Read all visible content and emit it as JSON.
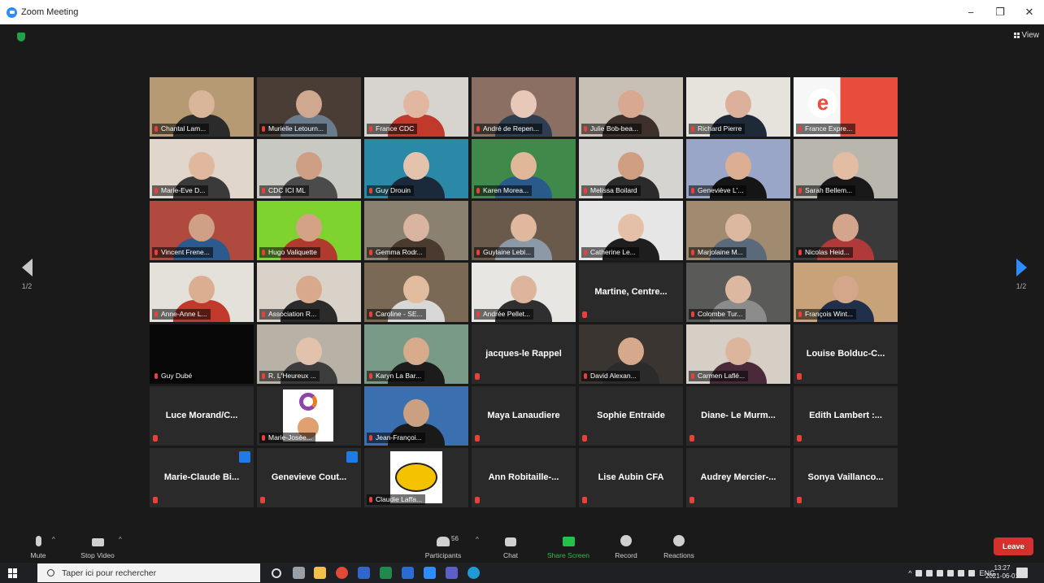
{
  "window": {
    "title": "Zoom Meeting",
    "minimize": "−",
    "maximize": "❐",
    "close": "✕"
  },
  "view": {
    "label": "View"
  },
  "pager": {
    "left": "1/2",
    "right": "1/2"
  },
  "tiles": [
    {
      "type": "video",
      "name": "Chantal Lam...",
      "bg": "#b59a73",
      "skin": "#d9b59a",
      "shirt": "#2b2b2b"
    },
    {
      "type": "video",
      "name": "Murielle Letourn...",
      "bg": "#4a3d35",
      "skin": "#d0a890",
      "shirt": "#6a7b8c"
    },
    {
      "type": "video",
      "name": "France  CDC",
      "bg": "#d7d3cf",
      "skin": "#e2b7a0",
      "shirt": "#c0392b"
    },
    {
      "type": "video",
      "name": "André de Repen...",
      "bg": "#8b6f62",
      "skin": "#e8c8b8",
      "shirt": "#2c3e50"
    },
    {
      "type": "video",
      "name": "Julie Bob-bea...",
      "bg": "#c8c0b4",
      "skin": "#d8a890",
      "shirt": "#3d2f2a"
    },
    {
      "type": "video",
      "name": "Richard Pierre",
      "bg": "#e6e3dd",
      "skin": "#dcb09a",
      "shirt": "#1f2a38"
    },
    {
      "type": "logo",
      "name": "France  Expre...",
      "bg": "#f7f7f7",
      "accent": "#e74c3c"
    },
    {
      "type": "video",
      "name": "Marie-Eve D...",
      "bg": "#e0d6cb",
      "skin": "#e0b89d",
      "shirt": "#3a3a3a"
    },
    {
      "type": "video",
      "name": "CDC ICI ML",
      "bg": "#c9c9c4",
      "skin": "#cf9f85",
      "shirt": "#4b4b4b"
    },
    {
      "type": "video",
      "name": "Guy Drouin",
      "bg": "#2b89a8",
      "skin": "#e4c3ad",
      "shirt": "#1b2a3a"
    },
    {
      "type": "video",
      "name": "Karen Morea...",
      "bg": "#3f8a4a",
      "skin": "#e0b798",
      "shirt": "#2a5a8a"
    },
    {
      "type": "video",
      "name": "Melissa Boilard",
      "bg": "#d6d4d0",
      "skin": "#d09f82",
      "shirt": "#2b2b2b"
    },
    {
      "type": "video",
      "name": "Geneviève L'...",
      "bg": "#9aa6c8",
      "skin": "#dcae92",
      "shirt": "#151515"
    },
    {
      "type": "video",
      "name": "Sarah Bellem...",
      "bg": "#b9b6ae",
      "skin": "#e2bca3",
      "shirt": "#181818"
    },
    {
      "type": "video",
      "name": "Vincent Frene...",
      "bg": "#b04a3e",
      "skin": "#cfa086",
      "shirt": "#2d5a8c"
    },
    {
      "type": "video",
      "name": "Hugo Valiquette",
      "bg": "#7ed32e",
      "skin": "#d4a284",
      "shirt": "#b03a2e",
      "active": true
    },
    {
      "type": "video",
      "name": "Gemma Rodr...",
      "bg": "#8a8170",
      "skin": "#d9b4a0",
      "shirt": "#4a3a30"
    },
    {
      "type": "video",
      "name": "Guylaine Lebl...",
      "bg": "#6a5a4c",
      "skin": "#dfb89e",
      "shirt": "#8c9aa8"
    },
    {
      "type": "video",
      "name": "Catherine Le...",
      "bg": "#e6e6e6",
      "skin": "#e5c0a8",
      "shirt": "#1e1e1e"
    },
    {
      "type": "video",
      "name": "Marjolaine M...",
      "bg": "#a08b70",
      "skin": "#ddb8a0",
      "shirt": "#5a6a7a"
    },
    {
      "type": "video",
      "name": "Nicolas Heid...",
      "bg": "#3a3a3a",
      "skin": "#d3a58c",
      "shirt": "#b03a3a"
    },
    {
      "type": "video",
      "name": "Anne-Anne L...",
      "bg": "#e4e0da",
      "skin": "#dbae92",
      "shirt": "#c0392b"
    },
    {
      "type": "video",
      "name": "Association R...",
      "bg": "#d8d2c9",
      "skin": "#d9a98d",
      "shirt": "#2b2b2b"
    },
    {
      "type": "video",
      "name": "Caroline - SE...",
      "bg": "#7a6a55",
      "skin": "#e1bc9f",
      "shirt": "#d8d8d8"
    },
    {
      "type": "video",
      "name": "Andrée Pellet...",
      "bg": "#e8e6e2",
      "skin": "#ddb49c",
      "shirt": "#2f2f2f"
    },
    {
      "type": "text",
      "name": "Martine,  Centre..."
    },
    {
      "type": "video",
      "name": "Colombe Tur...",
      "bg": "#5a5a58",
      "skin": "#dcb8a1",
      "shirt": "#8c8c8c"
    },
    {
      "type": "video",
      "name": "François Wint...",
      "bg": "#c8a278",
      "skin": "#d4a68a",
      "shirt": "#20304a"
    },
    {
      "type": "black",
      "name": "Guy Dubé"
    },
    {
      "type": "video",
      "name": "R. L'Heureux ...",
      "bg": "#b8b1a5",
      "skin": "#e3c2ad",
      "shirt": "#3c3c3c"
    },
    {
      "type": "video",
      "name": "Karyn La Bar...",
      "bg": "#7a9a88",
      "skin": "#d9ab8d",
      "shirt": "#1c1c1c"
    },
    {
      "type": "text",
      "name": "jacques-le Rappel"
    },
    {
      "type": "video",
      "name": "David Alexan...",
      "bg": "#3a3530",
      "skin": "#d6a98c",
      "shirt": "#2b2b2b"
    },
    {
      "type": "video",
      "name": "Carmen Laflé...",
      "bg": "#d5cfc6",
      "skin": "#ddb59c",
      "shirt": "#4a2a3a"
    },
    {
      "type": "text",
      "name": "Louise  Bolduc-C..."
    },
    {
      "type": "text",
      "name": "Luce  Morand/C..."
    },
    {
      "type": "logo1",
      "name": "Marie-Josée..."
    },
    {
      "type": "video",
      "name": "Jean-Françoi...",
      "bg": "#3a6fb0",
      "skin": "#caa080",
      "shirt": "#1a1a1a"
    },
    {
      "type": "text",
      "name": "Maya Lanaudiere"
    },
    {
      "type": "text",
      "name": "Sophie Entraide"
    },
    {
      "type": "text",
      "name": "Diane- Le Murm..."
    },
    {
      "type": "text",
      "name": "Edith  Lambert :..."
    },
    {
      "type": "text",
      "name": "Marie-Claude  Bi...",
      "badge": true
    },
    {
      "type": "text",
      "name": "Genevieve  Cout...",
      "badge": true
    },
    {
      "type": "logo2",
      "name": "Claudie Laffa..."
    },
    {
      "type": "text",
      "name": "Ann  Robitaille-..."
    },
    {
      "type": "text",
      "name": "Lise Aubin  CFA"
    },
    {
      "type": "text",
      "name": "Audrey  Mercier-..."
    },
    {
      "type": "text",
      "name": "Sonya  Vaillanco..."
    }
  ],
  "toolbar": {
    "mute": "Mute",
    "stop_video": "Stop Video",
    "participants": "Participants",
    "participants_count": "56",
    "chat": "Chat",
    "share_screen": "Share Screen",
    "record": "Record",
    "reactions": "Reactions",
    "leave": "Leave"
  },
  "taskbar": {
    "search_placeholder": "Taper ici pour rechercher",
    "lang": "ENG",
    "time": "13:27",
    "date": "2021-06-01"
  },
  "colors": {
    "accent": "#2D8CFF",
    "share_green": "#23c04c",
    "leave_red": "#d6302e",
    "muted_red": "#e8403b"
  }
}
